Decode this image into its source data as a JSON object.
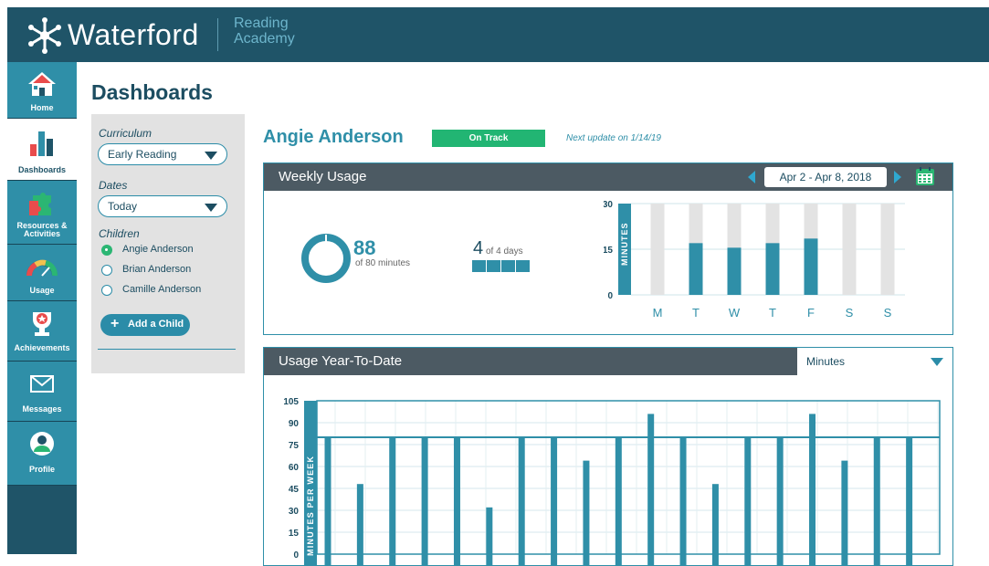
{
  "app": {
    "brand": "Waterford",
    "subtitle_line1": "Reading",
    "subtitle_line2": "Academy"
  },
  "sidebar": {
    "items": [
      {
        "label": "Home",
        "icon": "home-icon",
        "state": "teal"
      },
      {
        "label": "Dashboards",
        "icon": "bar-chart-icon",
        "state": "active"
      },
      {
        "label_line1": "Resources &",
        "label_line2": "Activities",
        "icon": "puzzle-icon",
        "state": "teal"
      },
      {
        "label": "Usage",
        "icon": "gauge-icon",
        "state": "teal"
      },
      {
        "label": "Achievements",
        "icon": "trophy-icon",
        "state": "teal"
      },
      {
        "label": "Messages",
        "icon": "envelope-icon",
        "state": "teal"
      },
      {
        "label": "Profile",
        "icon": "user-icon",
        "state": "teal"
      }
    ]
  },
  "page": {
    "title": "Dashboards"
  },
  "filters": {
    "curriculum_label": "Curriculum",
    "curriculum_value": "Early Reading",
    "dates_label": "Dates",
    "dates_value": "Today",
    "children_label": "Children",
    "children": [
      {
        "name": "Angie Anderson",
        "selected": true
      },
      {
        "name": "Brian Anderson",
        "selected": false
      },
      {
        "name": "Camille Anderson",
        "selected": false
      }
    ],
    "add_child": "Add a Child"
  },
  "student": {
    "name": "Angie Anderson",
    "status": "On Track",
    "next_update": "Next update on 1/14/19"
  },
  "weekly": {
    "title": "Weekly Usage",
    "date_range": "Apr 2 - Apr 8, 2018",
    "minutes_value": "88",
    "minutes_sub": "of 80 minutes",
    "days_value": "4",
    "days_sub": "of 4 days",
    "days_completed": 4
  },
  "ytd": {
    "title": "Usage Year-To-Date",
    "unit_select": "Minutes"
  },
  "chart_data": [
    {
      "type": "bar",
      "categories": [
        "M",
        "T",
        "W",
        "T",
        "F",
        "S",
        "S"
      ],
      "values": [
        0,
        17,
        15.5,
        17,
        18.5,
        0,
        0
      ],
      "ylabel": "MINUTES",
      "yticks": [
        "30",
        "15",
        "0"
      ],
      "ylim": [
        0,
        30
      ],
      "colors": {
        "bar": "#2f8fa8",
        "track": "#e3e3e3"
      }
    },
    {
      "type": "bar",
      "values": [
        80,
        48,
        80,
        80,
        80,
        32,
        80,
        80,
        64,
        80,
        96,
        80,
        48,
        80,
        80,
        96,
        64,
        80,
        80
      ],
      "target": 80,
      "ylabel": "MINUTES PER WEEK",
      "yticks": [
        "105",
        "90",
        "75",
        "60",
        "45",
        "30",
        "15",
        "0"
      ],
      "ylim": [
        0,
        105
      ],
      "colors": {
        "bar": "#2f8fa8"
      }
    }
  ]
}
